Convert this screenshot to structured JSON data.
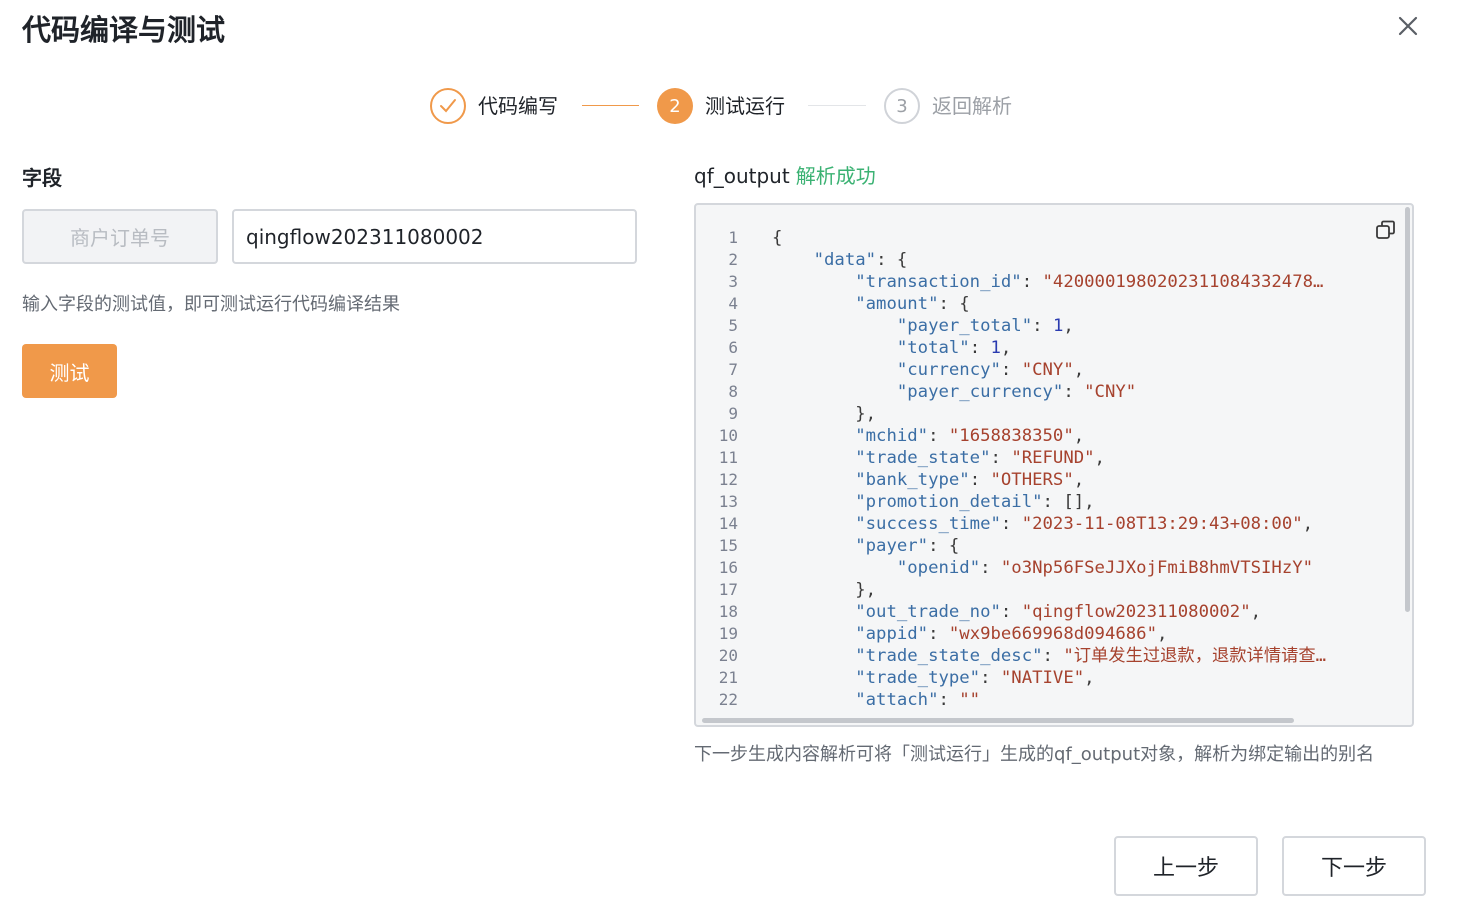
{
  "dialog": {
    "title": "代码编译与测试"
  },
  "steps": [
    {
      "label": "代码编写",
      "state": "done"
    },
    {
      "number": "2",
      "label": "测试运行",
      "state": "active"
    },
    {
      "number": "3",
      "label": "返回解析",
      "state": "pending"
    }
  ],
  "field_panel": {
    "section_label": "字段",
    "field_name": "商户订单号",
    "input_value": "qingflow202311080002",
    "hint": "输入字段的测试值，即可测试运行代码编译结果",
    "test_button": "测试"
  },
  "output_panel": {
    "label": "qf_output",
    "status": "解析成功",
    "code_lines": [
      "{",
      "    \"data\": {",
      "        \"transaction_id\": \"4200001980202311084332478…",
      "        \"amount\": {",
      "            \"payer_total\": 1,",
      "            \"total\": 1,",
      "            \"currency\": \"CNY\",",
      "            \"payer_currency\": \"CNY\"",
      "        },",
      "        \"mchid\": \"1658838350\",",
      "        \"trade_state\": \"REFUND\",",
      "        \"bank_type\": \"OTHERS\",",
      "        \"promotion_detail\": [],",
      "        \"success_time\": \"2023-11-08T13:29:43+08:00\",",
      "        \"payer\": {",
      "            \"openid\": \"o3Np56FSeJJXojFmiB8hmVTSIHzY\"",
      "        },",
      "        \"out_trade_no\": \"qingflow202311080002\",",
      "        \"appid\": \"wx9be669968d094686\",",
      "        \"trade_state_desc\": \"订单发生过退款，退款详情请查…",
      "        \"trade_type\": \"NATIVE\",",
      "        \"attach\": \"\""
    ],
    "description": "下一步生成内容解析可将「测试运行」生成的qf_output对象，解析为绑定输出的别名"
  },
  "footer": {
    "prev_button": "上一步",
    "next_button": "下一步"
  },
  "colors": {
    "accent": "#f0994a",
    "success": "#3bb273",
    "string": "#a6422e",
    "key": "#3b6ea5",
    "number": "#2a3bb0"
  }
}
